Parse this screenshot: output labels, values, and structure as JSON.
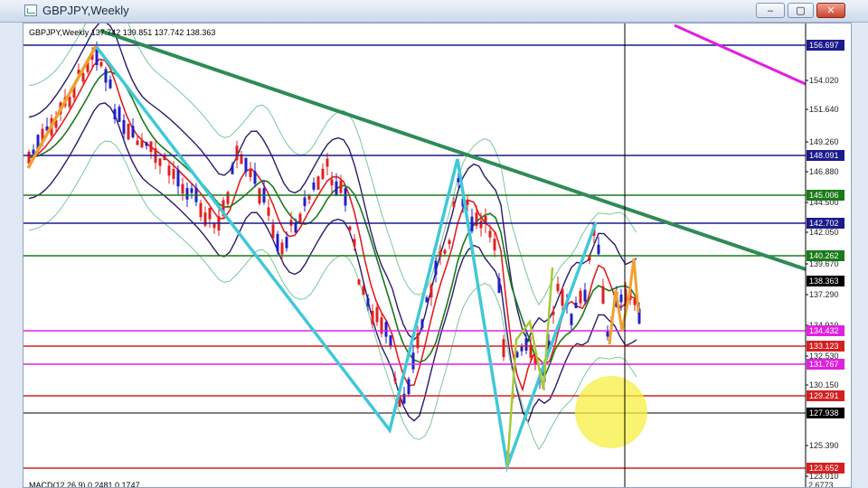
{
  "window": {
    "title": "GBPJPY,Weekly",
    "controls": {
      "minimize": "‒",
      "maximize": "▢",
      "close": "✕"
    }
  },
  "chart_info": {
    "header": "GBPJPY,Weekly  137.742 139.851 137.742 138.363",
    "macd_label": "MACD(12,26,9) 0.2481 0.1747"
  },
  "price_scale": [
    "154.020",
    "151.640",
    "149.260",
    "146.880",
    "144.500",
    "142.050",
    "139.670",
    "137.290",
    "134.910",
    "132.530",
    "130.150",
    "125.390",
    "123.010"
  ],
  "macd_scale": "2.6773",
  "levels": [
    {
      "id": "top",
      "label": "156.697",
      "color": "#1b1b8c"
    },
    {
      "id": "r1",
      "label": "148.091",
      "color": "#1b1b8c"
    },
    {
      "id": "r2",
      "label": "145.006",
      "color": "#1a7a1a"
    },
    {
      "id": "r3",
      "label": "142.702",
      "color": "#1b1b8c"
    },
    {
      "id": "r4",
      "label": "140.262",
      "color": "#1a7a1a"
    },
    {
      "id": "bid",
      "label": "138.363",
      "color": "#000000"
    },
    {
      "id": "s1",
      "label": "134.432",
      "color": "#e020e0"
    },
    {
      "id": "s2",
      "label": "133.123",
      "color": "#d42020"
    },
    {
      "id": "s3",
      "label": "131.767",
      "color": "#e020e0"
    },
    {
      "id": "s4",
      "label": "129.291",
      "color": "#d42020"
    },
    {
      "id": "s5",
      "label": "127.938",
      "color": "#000000"
    },
    {
      "id": "s6",
      "label": "123.652",
      "color": "#d42020"
    }
  ],
  "colors": {
    "bull_candle": "#2020c8",
    "bear_candle": "#e02020",
    "trendline_main": "#2e8b57",
    "trendline_magenta": "#e020e0",
    "swing_cyan": "#40c8d8",
    "swing_orange": "#f0a030",
    "highlight_circle": "#f5ef40"
  }
}
